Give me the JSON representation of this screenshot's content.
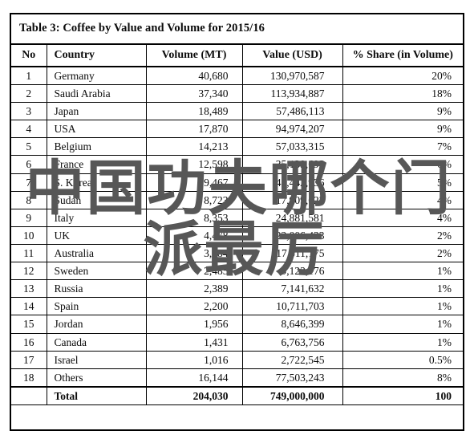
{
  "document": {
    "title": "Table 3: Coffee by Value and Volume for 2015/16"
  },
  "table": {
    "columns": [
      {
        "key": "no",
        "label": "No"
      },
      {
        "key": "country",
        "label": "Country"
      },
      {
        "key": "volume",
        "label": "Volume (MT)"
      },
      {
        "key": "value",
        "label": "Value (USD)"
      },
      {
        "key": "share",
        "label": "% Share (in Volume)"
      }
    ],
    "rows": [
      {
        "no": "1",
        "country": "Germany",
        "volume": "40,680",
        "value": "130,970,587",
        "share": "20%"
      },
      {
        "no": "2",
        "country": "Saudi Arabia",
        "volume": "37,340",
        "value": "113,934,887",
        "share": "18%"
      },
      {
        "no": "3",
        "country": "Japan",
        "volume": "18,489",
        "value": "57,486,113",
        "share": "9%"
      },
      {
        "no": "4",
        "country": "USA",
        "volume": "17,870",
        "value": "94,974,207",
        "share": "9%"
      },
      {
        "no": "5",
        "country": "Belgium",
        "volume": "14,213",
        "value": "57,033,315",
        "share": "7%"
      },
      {
        "no": "6",
        "country": "France",
        "volume": "12,598",
        "value": "35,139,692",
        "share": "6%"
      },
      {
        "no": "7",
        "country": "S. Korea",
        "volume": "9,467",
        "value": "41,442,936",
        "share": "5%"
      },
      {
        "no": "8",
        "country": "Sudan",
        "volume": "8,723",
        "value": "17,909,623",
        "share": "4%"
      },
      {
        "no": "9",
        "country": "Italy",
        "volume": "8,353",
        "value": "24,881,581",
        "share": "4%"
      },
      {
        "no": "10",
        "country": "UK",
        "volume": "4,478",
        "value": "22,006,433",
        "share": "2%"
      },
      {
        "no": "11",
        "country": "Australia",
        "volume": "3,884",
        "value": "17,511,175",
        "share": "2%"
      },
      {
        "no": "12",
        "country": "Sweden",
        "volume": "2,485",
        "value": "9,122,176",
        "share": "1%"
      },
      {
        "no": "13",
        "country": "Russia",
        "volume": "2,389",
        "value": "7,141,632",
        "share": "1%"
      },
      {
        "no": "14",
        "country": "Spain",
        "volume": "2,200",
        "value": "10,711,703",
        "share": "1%"
      },
      {
        "no": "15",
        "country": "Jordan",
        "volume": "1,956",
        "value": "8,646,399",
        "share": "1%"
      },
      {
        "no": "16",
        "country": "Canada",
        "volume": "1,431",
        "value": "6,763,756",
        "share": "1%"
      },
      {
        "no": "17",
        "country": "Israel",
        "volume": "1,016",
        "value": "2,722,545",
        "share": "0.5%"
      },
      {
        "no": "18",
        "country": "Others",
        "volume": "16,144",
        "value": "77,503,243",
        "share": "8%"
      }
    ],
    "total": {
      "no": "",
      "country": "Total",
      "volume": "204,030",
      "value": "749,000,000",
      "share": "100"
    }
  },
  "watermark": {
    "line1": "中国功夫哪个门",
    "line2": "派最厉",
    "color": "#575757"
  }
}
